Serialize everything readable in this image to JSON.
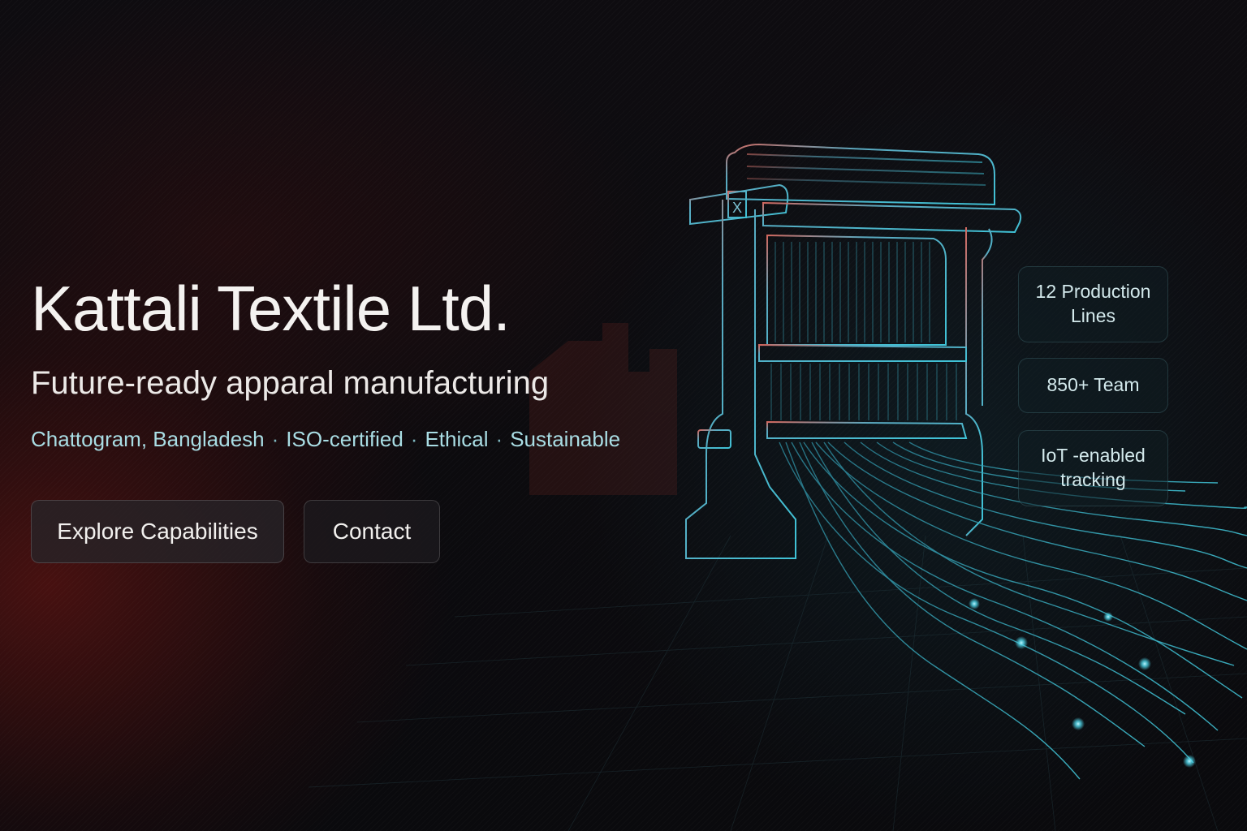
{
  "hero": {
    "title": "Kattali Textile Ltd.",
    "tagline": "Future-ready apparal manufacturing",
    "features": [
      "Chattogram, Bangladesh",
      "ISO-certified",
      "Ethical",
      "Sustainable"
    ],
    "feature_separator": "·"
  },
  "actions": {
    "explore_label": "Explore Capabilities",
    "contact_label": "Contact"
  },
  "stats": [
    "12 Production Lines",
    "850+ Team",
    "IoT -enabled tracking"
  ],
  "illustration": {
    "icon": "loom-icon",
    "loom_marker": "X",
    "accent_color": "#3fc2d6",
    "warm_color": "#d05a50"
  }
}
